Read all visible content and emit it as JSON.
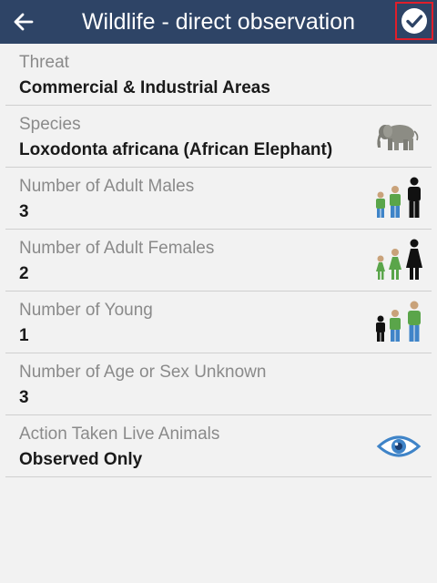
{
  "appbar": {
    "title": "Wildlife - direct observation",
    "back_icon": "arrow-left-icon",
    "save_icon": "check-circle-icon"
  },
  "fields": [
    {
      "label": "Threat",
      "value": "Commercial & Industrial Areas"
    },
    {
      "label": "Species",
      "value": "Loxodonta africana (African Elephant)",
      "icon": "elephant-icon"
    },
    {
      "label": "Number of Adult Males",
      "value": "3",
      "icon": "adult-males-icon"
    },
    {
      "label": "Number of Adult Females",
      "value": "2",
      "icon": "adult-females-icon"
    },
    {
      "label": "Number of Young",
      "value": "1",
      "icon": "young-icon"
    },
    {
      "label": "Number of Age or Sex Unknown",
      "value": "3"
    },
    {
      "label": "Action Taken Live Animals",
      "value": "Observed Only",
      "icon": "eye-icon"
    }
  ],
  "colors": {
    "appbar": "#2e4466",
    "highlight_border": "#e01e2a",
    "figure_green": "#5aa54a",
    "figure_blue": "#3f84c8"
  }
}
